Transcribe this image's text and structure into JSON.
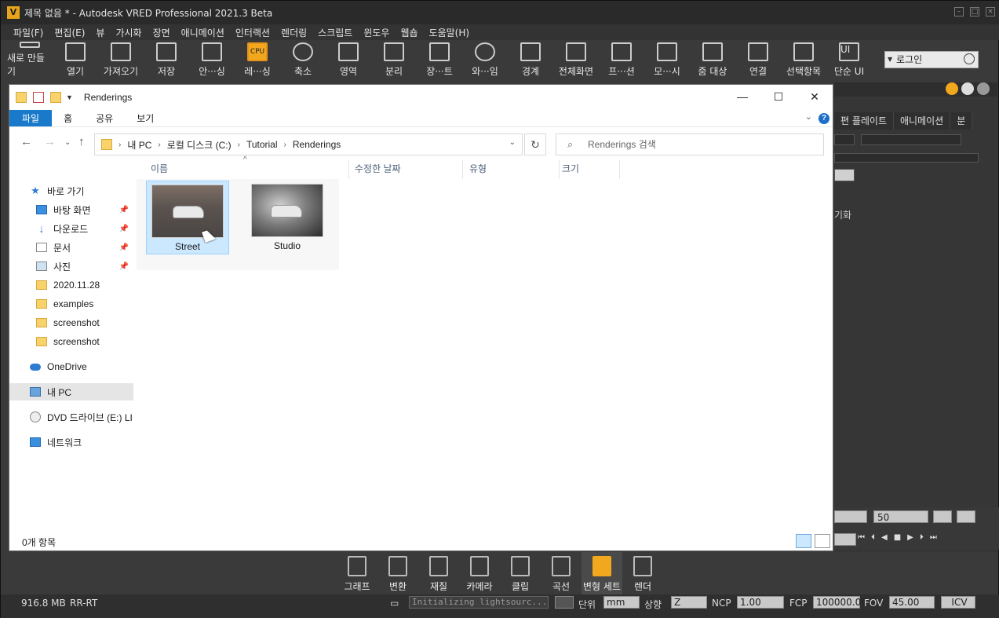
{
  "app": {
    "title": "제목 없음 * - Autodesk VRED Professional 2021.3 Beta",
    "logo": "V"
  },
  "menu": [
    "파일(F)",
    "편집(E)",
    "뷰",
    "가시화",
    "장면",
    "애니메이션",
    "인터랙션",
    "렌더링",
    "스크립트",
    "윈도우",
    "웹숍",
    "도움말(H)"
  ],
  "toolbar": [
    {
      "label": "새로 만들기",
      "icon": "new-file-icon"
    },
    {
      "label": "열기",
      "icon": "open-folder-icon"
    },
    {
      "label": "가져오기",
      "icon": "import-icon"
    },
    {
      "label": "저장",
      "icon": "save-icon"
    },
    {
      "label": "안···싱",
      "icon": "antialiasing-icon"
    },
    {
      "label": "레···싱",
      "icon": "cpu-raytracing-icon",
      "badge": "CPU"
    },
    {
      "label": "축소",
      "icon": "shrink-icon"
    },
    {
      "label": "영역",
      "icon": "region-icon"
    },
    {
      "label": "분리",
      "icon": "isolate-icon"
    },
    {
      "label": "장···트",
      "icon": "scene-icon"
    },
    {
      "label": "와···임",
      "icon": "wireframe-icon"
    },
    {
      "label": "경계",
      "icon": "bounds-icon"
    },
    {
      "label": "전체화면",
      "icon": "fullscreen-icon"
    },
    {
      "label": "프···션",
      "icon": "projection-icon"
    },
    {
      "label": "모···시",
      "icon": "all-view-icon"
    },
    {
      "label": "줌 대상",
      "icon": "zoom-target-icon"
    },
    {
      "label": "연결",
      "icon": "connect-icon"
    },
    {
      "label": "선택항목",
      "icon": "selection-icon"
    },
    {
      "label": "단순 UI",
      "icon": "simple-ui-icon",
      "badge": "UI"
    }
  ],
  "login": {
    "label": "로그인"
  },
  "right_panel": {
    "tabs": [
      "편 플레이트",
      "애니메이션",
      "분"
    ],
    "text": "기화"
  },
  "playback": {
    "value": "50"
  },
  "modules": [
    {
      "label": "그래프",
      "icon": "graph-icon"
    },
    {
      "label": "변환",
      "icon": "transform-icon"
    },
    {
      "label": "재질",
      "icon": "material-icon"
    },
    {
      "label": "카메라",
      "icon": "camera-icon"
    },
    {
      "label": "클립",
      "icon": "clip-icon"
    },
    {
      "label": "곡선",
      "icon": "curve-icon"
    },
    {
      "label": "변형 세트",
      "icon": "variant-set-icon",
      "active": true
    },
    {
      "label": "렌더",
      "icon": "render-icon"
    }
  ],
  "status": {
    "memory": "916.8 MB",
    "mode": "RR-RT",
    "message": "Initializing lightsourc...",
    "unit_label": "단위",
    "unit_value": "mm",
    "up_label": "상향",
    "up_value": "Z",
    "ncp_label": "NCP",
    "ncp_value": "1.00",
    "fcp_label": "FCP",
    "fcp_value": "100000.00",
    "fov_label": "FOV",
    "fov_value": "45.00",
    "icv_label": "ICV"
  },
  "explorer": {
    "title": "Renderings",
    "ribbon_tabs": [
      "파일",
      "홈",
      "공유",
      "보기"
    ],
    "address": [
      "내 PC",
      "로컬 디스크 (C:)",
      "Tutorial",
      "Renderings"
    ],
    "search_placeholder": "Renderings 검색",
    "nav": [
      {
        "label": "바로 가기",
        "icon": "star-icon",
        "kind": "star"
      },
      {
        "label": "바탕 화면",
        "icon": "desktop-icon",
        "kind": "desk",
        "pinned": true
      },
      {
        "label": "다운로드",
        "icon": "download-icon",
        "kind": "down",
        "pinned": true
      },
      {
        "label": "문서",
        "icon": "document-icon",
        "kind": "doc",
        "pinned": true
      },
      {
        "label": "사진",
        "icon": "picture-icon",
        "kind": "pic",
        "pinned": true
      },
      {
        "label": "2020.11.28",
        "icon": "folder-icon",
        "kind": "fold"
      },
      {
        "label": "examples",
        "icon": "folder-icon",
        "kind": "fold"
      },
      {
        "label": "screenshot",
        "icon": "folder-icon",
        "kind": "fold"
      },
      {
        "label": "screenshot",
        "icon": "folder-icon",
        "kind": "fold"
      },
      {
        "label": "OneDrive",
        "icon": "onedrive-icon",
        "kind": "cloud"
      },
      {
        "label": "내 PC",
        "icon": "pc-icon",
        "kind": "pc",
        "selected": true
      },
      {
        "label": "DVD 드라이브 (E:) LI",
        "icon": "dvd-icon",
        "kind": "dvd"
      },
      {
        "label": "네트워크",
        "icon": "network-icon",
        "kind": "net"
      }
    ],
    "columns": [
      "이름",
      "수정한 날짜",
      "유형",
      "크기"
    ],
    "files": [
      {
        "name": "Street",
        "selected": true
      },
      {
        "name": "Studio",
        "selected": false
      }
    ],
    "item_count": "0개 항목"
  }
}
